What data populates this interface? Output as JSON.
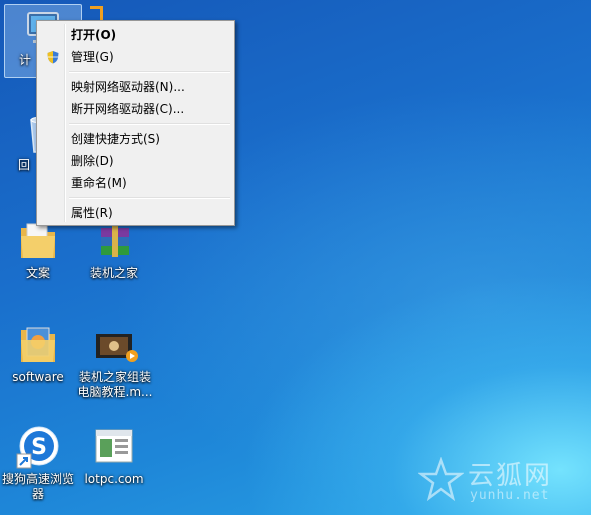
{
  "context_menu": {
    "items": [
      {
        "label": "打开(O)"
      },
      {
        "label": "管理(G)"
      },
      {
        "label": "映射网络驱动器(N)..."
      },
      {
        "label": "断开网络驱动器(C)..."
      },
      {
        "label": "创建快捷方式(S)"
      },
      {
        "label": "删除(D)"
      },
      {
        "label": "重命名(M)"
      },
      {
        "label": "属性(R)"
      }
    ]
  },
  "desktop": {
    "icons": [
      {
        "label": "计",
        "icon": "computer-icon"
      },
      {
        "label": "回",
        "icon": "recycle-bin-icon"
      },
      {
        "label": "文案",
        "icon": "folder-icon"
      },
      {
        "label": "装机之家",
        "icon": "winrar-archive-icon"
      },
      {
        "label": "software",
        "icon": "folder-icon"
      },
      {
        "label": "装机之家组装电脑教程.m...",
        "icon": "video-file-icon"
      },
      {
        "label": "搜狗高速浏览器",
        "icon": "sogou-browser-icon"
      },
      {
        "label": "lotpc.com",
        "icon": "webpage-shortcut-icon"
      }
    ]
  },
  "watermark": {
    "text": "云狐网",
    "sub": "yunhu.net"
  }
}
